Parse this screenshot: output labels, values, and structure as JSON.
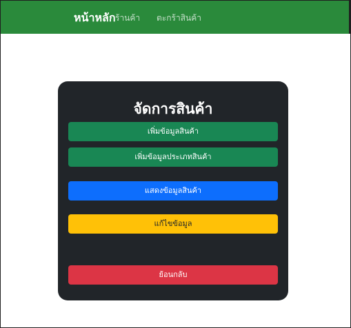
{
  "navbar": {
    "brand": "หน้าหลัก",
    "links": [
      "ร้านค้า",
      "ตะกร้าสินค้า"
    ],
    "bg_color": "#2a8a3b"
  },
  "card": {
    "title": "จัดการสินค้า",
    "buttons": {
      "add_product": "เพิ่มข้อมูลสินค้า",
      "add_product_type": "เพิ่มข้อมูลประเภทสินค้า",
      "show_products": "แสดงข้อมูลสินค้า",
      "edit": "แก้ไขข้อมูล",
      "back": "ย้อนกลับ"
    },
    "colors": {
      "card_bg": "#212529",
      "success": "#198754",
      "primary": "#0d6efd",
      "warning": "#ffc107",
      "danger": "#dc3545"
    }
  }
}
